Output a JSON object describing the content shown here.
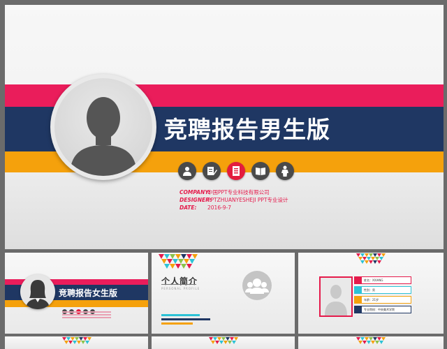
{
  "main_slide": {
    "title": "竞聘报告男生版",
    "info": [
      {
        "label": "COMPANY:",
        "value": "中国PPT专业科技有限公司"
      },
      {
        "label": "DESIGNER:",
        "value": "PPTZHUANYESHEJI PPT专业设计"
      },
      {
        "label": "DATE:",
        "value": "2016-9-7"
      }
    ],
    "icons": [
      "person-icon",
      "document-edit-icon",
      "list-icon",
      "book-icon",
      "figure-icon"
    ]
  },
  "thumbnails": {
    "female_version": {
      "title": "竞聘报告女生版"
    },
    "profile": {
      "heading": "个人简介",
      "subheading": "PERSONAL PROFILE"
    },
    "details": {
      "rows": [
        {
          "text": "姓名：XXIANG",
          "color": "#e51a4b"
        },
        {
          "text": "性别：男",
          "color": "#2cc2d6"
        },
        {
          "text": "年龄：21岁",
          "color": "#f5a10c"
        },
        {
          "text": "专业院校：中央美术学院",
          "color": "#1f3763"
        }
      ]
    }
  },
  "colors": {
    "pink": "#ea1d5b",
    "navy": "#1f3763",
    "orange": "#f5a10c",
    "red_accent": "#e31c3d"
  }
}
